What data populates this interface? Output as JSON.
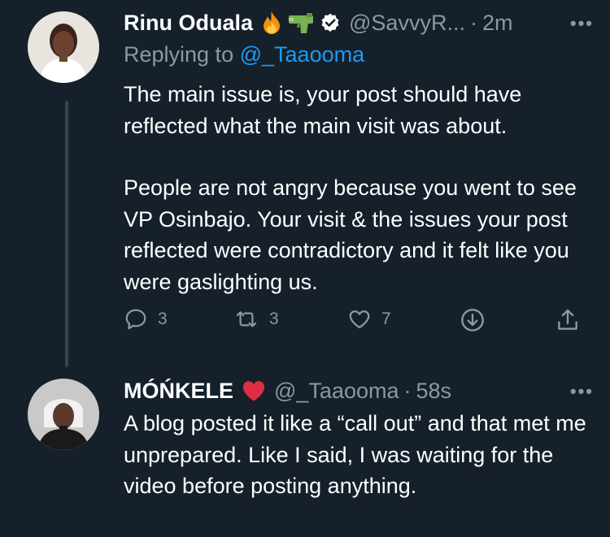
{
  "tweet1": {
    "author_name": "Rinu Oduala",
    "handle": "@SavvyR...",
    "separator": "·",
    "time": "2m",
    "more": "•••",
    "replying_prefix": "Replying to",
    "replying_handle": "@_Taaooma",
    "paragraphs": [
      "The main issue is, your post should have reflected what the main visit was about.",
      "People are not angry because you went to see VP Osinbajo. Your visit & the issues your post reflected were contradictory and it felt like you were gaslighting us."
    ],
    "actions": {
      "reply_count": "3",
      "retweet_count": "3",
      "like_count": "7"
    },
    "icons": [
      "fire-emoji",
      "water-pistol-emoji",
      "verified-badge"
    ]
  },
  "tweet2": {
    "author_name": "MÓŃKELE",
    "handle": "@_Taaooma",
    "separator": "·",
    "time": "58s",
    "more": "•••",
    "text": "A blog posted it like a “call out” and that met me unprepared. Like I said, I was waiting for the video before posting anything.",
    "icons": [
      "red-heart-emoji"
    ]
  },
  "colors": {
    "background": "#15202b",
    "text": "#ffffff",
    "muted": "#8899a6",
    "link": "#1d9bf0",
    "thread_line": "#38444d"
  }
}
